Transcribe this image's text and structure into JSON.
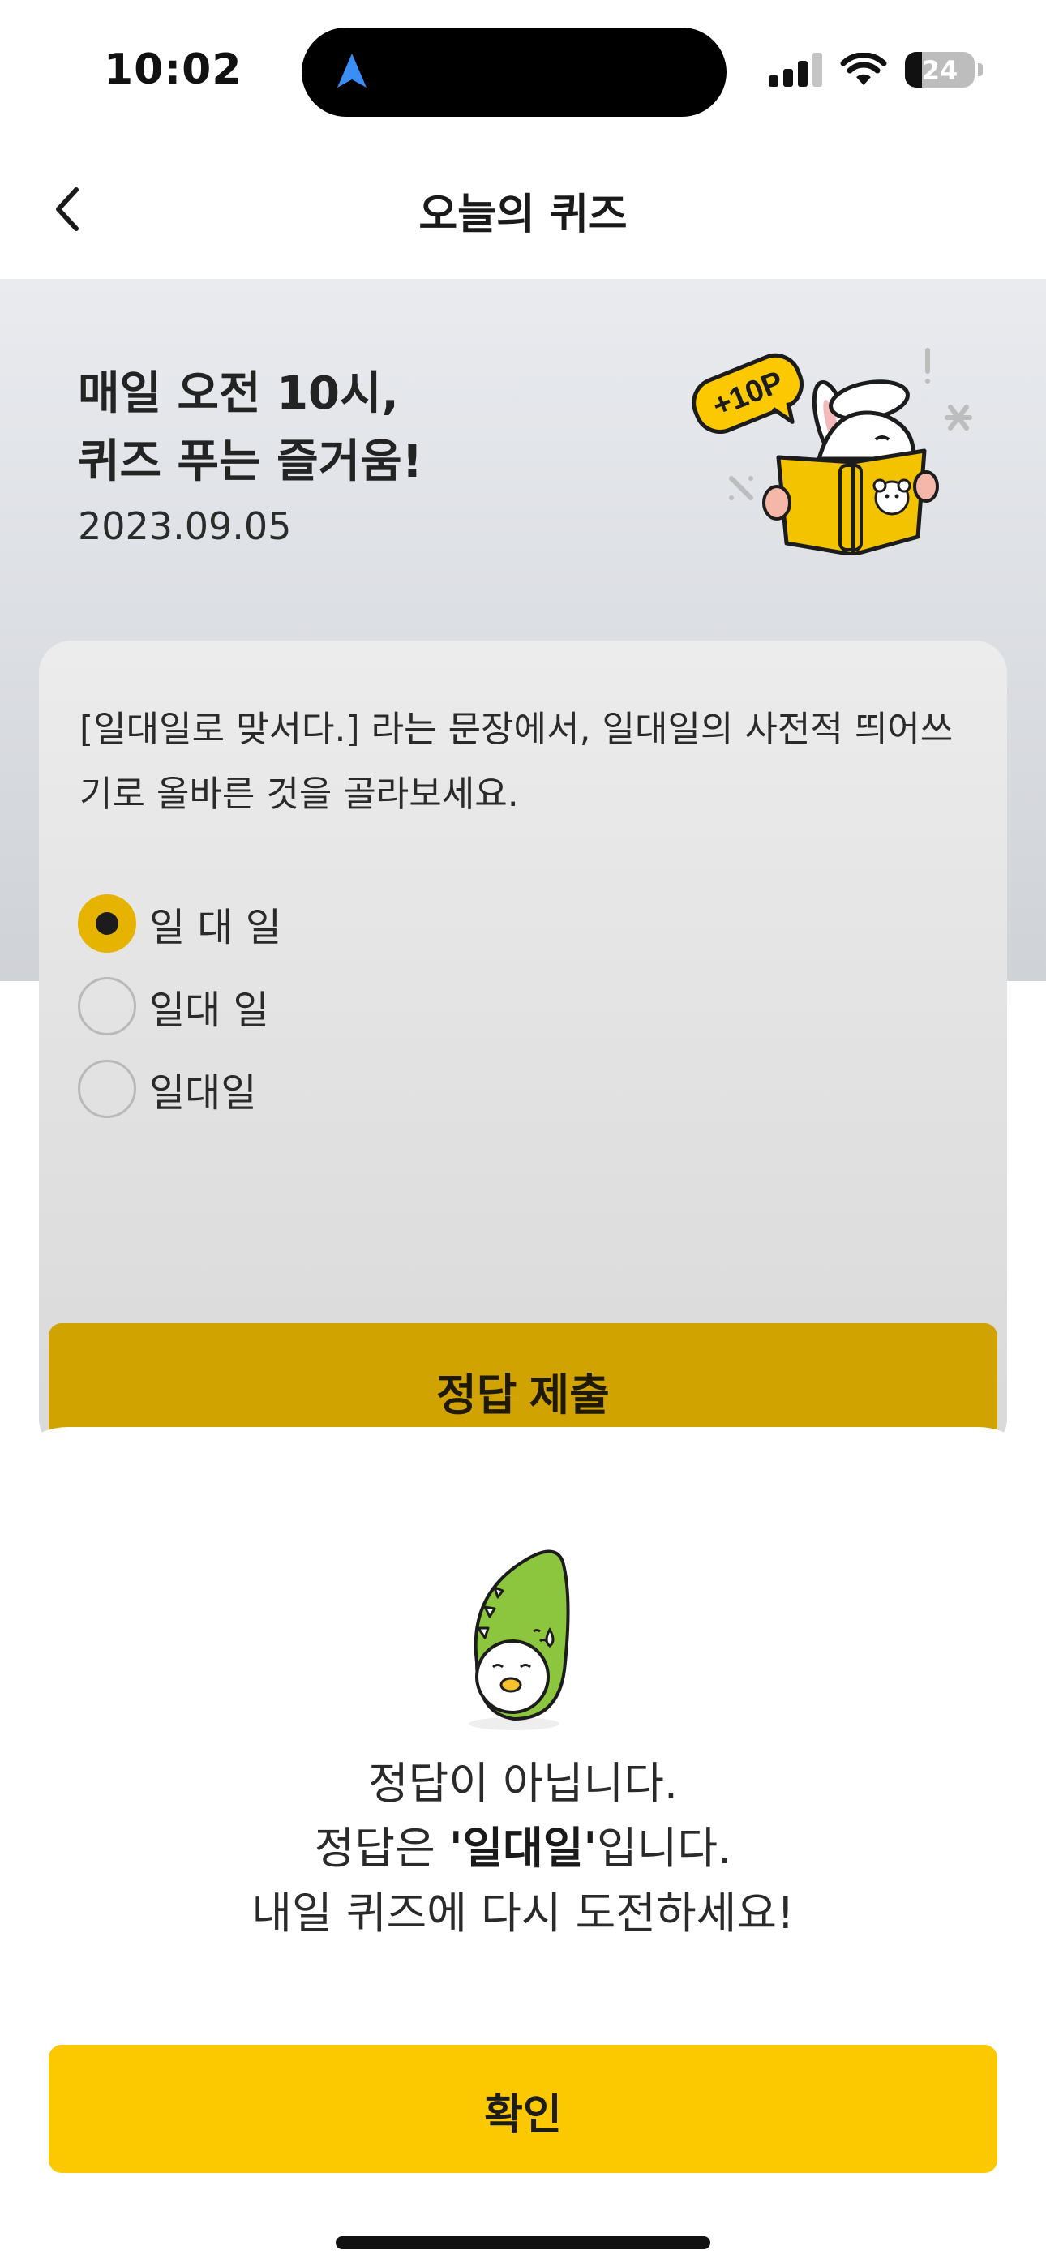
{
  "status_bar": {
    "time": "10:02",
    "battery_level": "24"
  },
  "nav": {
    "title": "오늘의 퀴즈"
  },
  "hero": {
    "title_line1": "매일 오전 10시,",
    "title_line2": "퀴즈 푸는 즐거움!",
    "date": "2023.09.05",
    "badge": "+10P"
  },
  "quiz": {
    "question": "[일대일로 맞서다.] 라는 문장에서, 일대일의 사전적 띄어쓰기로 올바른 것을 골라보세요.",
    "options": [
      {
        "label": "일 대 일",
        "selected": true
      },
      {
        "label": "일대 일",
        "selected": false
      },
      {
        "label": "일대일",
        "selected": false
      }
    ],
    "submit_label": "정답 제출"
  },
  "result_sheet": {
    "line1": "정답이 아닙니다.",
    "line2_prefix": "정답은 ",
    "line2_answer": "'일대일'",
    "line2_suffix": "입니다.",
    "line3": "내일 퀴즈에 다시 도전하세요!",
    "confirm_label": "확인"
  },
  "colors": {
    "accent_yellow": "#FCC900",
    "selected_radio": "#E6B400",
    "dimmed_button": "#D0A300"
  }
}
